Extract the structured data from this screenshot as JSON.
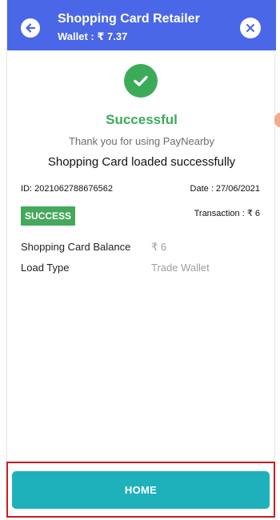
{
  "header": {
    "title": "Shopping Card Retailer",
    "wallet": "Wallet : ₹ 7.37",
    "bg_color": "#4a67e8"
  },
  "icons": {
    "back": "back-arrow-icon",
    "close": "close-icon",
    "status": "check-circle-icon"
  },
  "status": {
    "title": "Successful",
    "thanks": "Thank you for using PayNearby",
    "message": "Shopping Card loaded successfully",
    "color": "#3cab59"
  },
  "transaction": {
    "id": "ID: 2021062788676562",
    "date": "Date : 27/06/2021",
    "badge": "SUCCESS",
    "amount": "Transaction : ₹ 6"
  },
  "details": [
    {
      "label": "Shopping Card Balance",
      "value": "₹ 6"
    },
    {
      "label": "Load Type",
      "value": "Trade Wallet"
    }
  ],
  "footer": {
    "home_label": "HOME",
    "button_color": "#1fb1bb"
  }
}
